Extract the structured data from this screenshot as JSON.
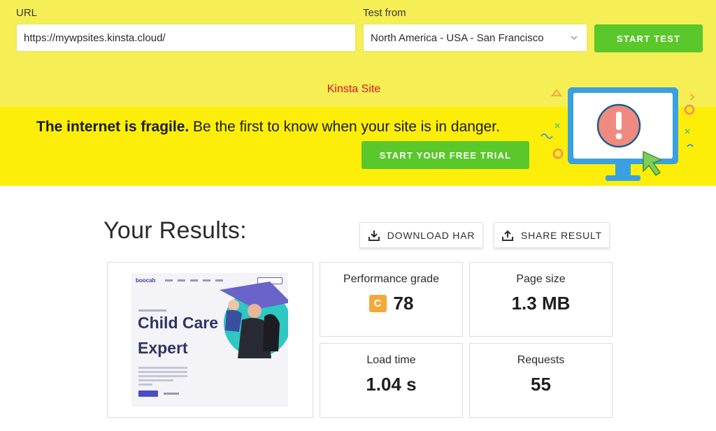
{
  "test_form": {
    "url_label": "URL",
    "url_value": "https://mywpsites.kinsta.cloud/",
    "test_from_label": "Test from",
    "test_from_value": "North America - USA - San Francisco",
    "start_button": "START TEST"
  },
  "site_title": "Kinsta Site",
  "banner": {
    "headline_bold": "The internet is fragile.",
    "headline_rest": " Be the first to know when your site is in danger.",
    "cta": "START YOUR FREE TRIAL"
  },
  "results": {
    "title": "Your Results:",
    "download_label": "DOWNLOAD HAR",
    "share_label": "SHARE RESULT",
    "metrics": [
      {
        "label": "Performance grade",
        "grade": "C",
        "value": "78"
      },
      {
        "label": "Page size",
        "value": "1.3 MB"
      },
      {
        "label": "Load time",
        "value": "1.04 s"
      },
      {
        "label": "Requests",
        "value": "55"
      }
    ]
  },
  "screenshot_thumb": {
    "brand": "boocah",
    "headline_line1": "Child Care",
    "headline_line2": "Expert"
  },
  "colors": {
    "test_bar_bg": "#f5ee55",
    "banner_bg": "#fcee09",
    "accent_green": "#5ac72b",
    "site_title_red": "#e2141c",
    "grade_orange": "#f2a93b"
  },
  "icons": [
    "chevron-down-icon",
    "download-icon",
    "share-icon",
    "monitor-alert-illustration"
  ]
}
